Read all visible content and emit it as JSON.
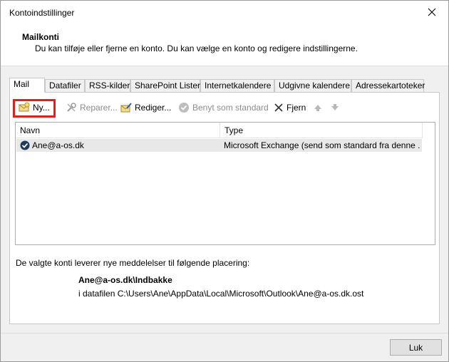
{
  "window": {
    "title": "Kontoindstillinger",
    "close_glyph": "✕"
  },
  "header": {
    "title": "Mailkonti",
    "description": "Du kan tilføje eller fjerne en konto. Du kan vælge en konto og redigere indstillingerne."
  },
  "tabs": [
    {
      "label": "Mail",
      "active": true
    },
    {
      "label": "Datafiler"
    },
    {
      "label": "RSS-kilder"
    },
    {
      "label": "SharePoint Lister"
    },
    {
      "label": "Internetkalendere"
    },
    {
      "label": "Udgivne kalendere"
    },
    {
      "label": "Adressekartoteker"
    }
  ],
  "toolbar": {
    "new_label": "Ny...",
    "repair_label": "Reparer...",
    "edit_label": "Rediger...",
    "default_label": "Benyt som standard",
    "remove_label": "Fjern"
  },
  "list": {
    "col_name": "Navn",
    "col_type": "Type",
    "rows": [
      {
        "name": "Ane@a-os.dk",
        "type": "Microsoft Exchange (send som standard fra denne ..."
      }
    ]
  },
  "delivery": {
    "label": "De valgte konti leverer nye meddelelser til følgende placering:",
    "folder": "Ane@a-os.dk\\Indbakke",
    "file": "i datafilen C:\\Users\\Ane\\AppData\\Local\\Microsoft\\Outlook\\Ane@a-os.dk.ost"
  },
  "footer": {
    "close_label": "Luk"
  },
  "colors": {
    "highlight": "#e0201d",
    "selected_row": "#e8e8e8"
  }
}
